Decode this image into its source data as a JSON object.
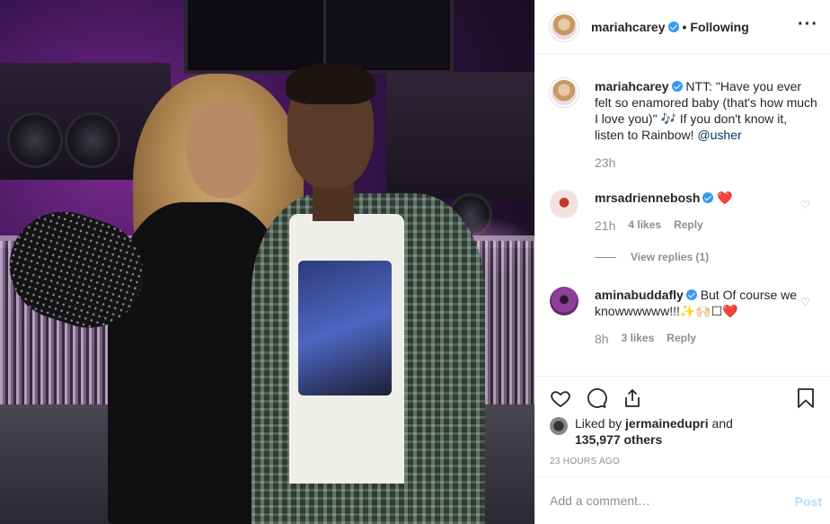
{
  "header": {
    "username": "mariahcarey",
    "separator": "•",
    "follow_status": "Following",
    "more_label": "···"
  },
  "caption": {
    "username": "mariahcarey",
    "text_before": " NTT: \"Have you ever felt so enamored baby (that's how much I love you)\" 🎶 If you don't know it, listen to Rainbow! ",
    "mention": "@usher",
    "time": "23h"
  },
  "comments": [
    {
      "username": "mrsadriennebosh",
      "text": "❤️",
      "time": "21h",
      "likes": "4 likes",
      "reply_label": "Reply"
    },
    {
      "username": "aminabuddafly",
      "text": "But Of course we knowwwwww!!!✨🙌🏻☐❤️",
      "time": "8h",
      "likes": "3 likes",
      "reply_label": "Reply"
    }
  ],
  "view_replies": "View replies (1)",
  "likes": {
    "prefix": "Liked by ",
    "user": "jermainedupri",
    "middle": " and",
    "count": "135,977 others"
  },
  "timestamp": "23 HOURS AGO",
  "add_comment": {
    "placeholder": "Add a comment…",
    "post_label": "Post"
  },
  "colors": {
    "verified": "#3897f0",
    "mention": "#003569",
    "muted": "#8e8e8e",
    "post_disabled": "#b2dffc"
  },
  "icons": [
    "heart-icon",
    "comment-icon",
    "share-icon",
    "bookmark-icon",
    "verified-badge-icon",
    "more-icon"
  ]
}
